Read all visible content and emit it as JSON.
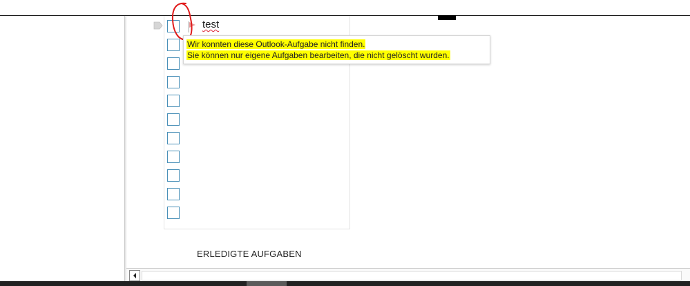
{
  "task": {
    "title": "test"
  },
  "tooltip": {
    "line1": "Wir konnten diese Outlook-Aufgabe nicht finden.",
    "line2": "Sie können nur eigene Aufgaben bearbeiten, die nicht gelöscht wurden."
  },
  "sections": {
    "completed_label": "ERLEDIGTE AUFGABEN"
  },
  "colors": {
    "checkbox_border": "#4a90b8",
    "tooltip_highlight": "#ffff00",
    "annotation_circle": "#e01b1b",
    "flag": "#e8a0a0"
  },
  "icons": {
    "flag": "flag-icon",
    "drag_handle": "drag-handle-icon",
    "scroll_left": "chevron-left-icon"
  }
}
